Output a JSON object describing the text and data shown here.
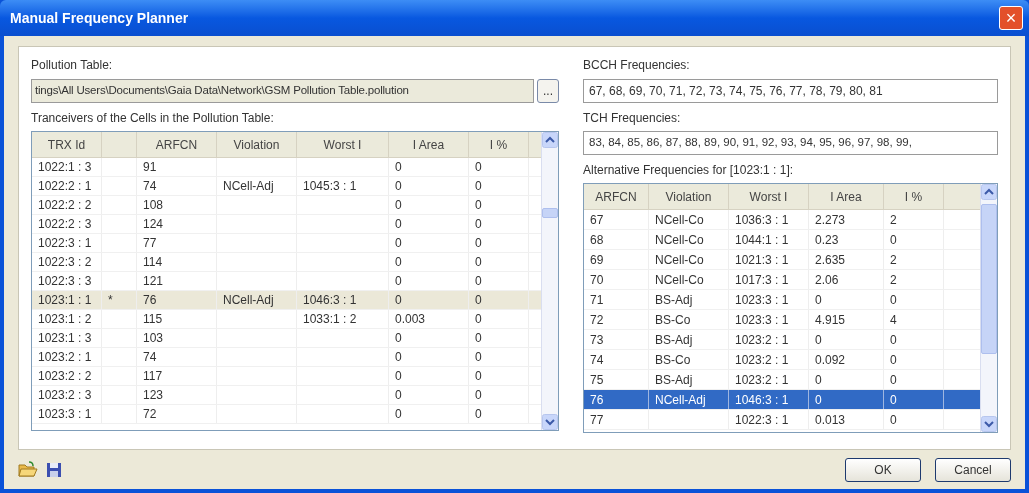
{
  "window": {
    "title": "Manual Frequency Planner",
    "close": "×"
  },
  "pollution_table": {
    "label": "Pollution Table:",
    "value": "tings\\All Users\\Documents\\Gaia Data\\Network\\GSM Pollution Table.pollution",
    "browse_button": "..."
  },
  "transceivers": {
    "label": "Tranceivers of the Cells in the Pollution Table:",
    "columns": [
      "TRX Id",
      "ARFCN",
      "Violation",
      "Worst I",
      "I Area",
      "I %"
    ],
    "rows": [
      {
        "trx_id": "1022:1 : 3",
        "arfcn": "91",
        "i_area": "0",
        "i_pct": "0",
        "selected": false
      },
      {
        "trx_id": "1022:2 : 1",
        "arfcn": "74",
        "violation": "NCell-Adj",
        "worst_i": "1045:3 : 1",
        "i_area": "0",
        "i_pct": "0",
        "selected": false
      },
      {
        "trx_id": "1022:2 : 2",
        "arfcn": "108",
        "i_area": "0",
        "i_pct": "0",
        "selected": false
      },
      {
        "trx_id": "1022:2 : 3",
        "arfcn": "124",
        "i_area": "0",
        "i_pct": "0",
        "selected": false
      },
      {
        "trx_id": "1022:3 : 1",
        "arfcn": "77",
        "i_area": "0",
        "i_pct": "0",
        "selected": false
      },
      {
        "trx_id": "1022:3 : 2",
        "arfcn": "114",
        "i_area": "0",
        "i_pct": "0",
        "selected": false
      },
      {
        "trx_id": "1022:3 : 3",
        "arfcn": "121",
        "i_area": "0",
        "i_pct": "0",
        "selected": false
      },
      {
        "trx_id": "1023:1 : 1",
        "marker": "*",
        "arfcn": "76",
        "violation": "NCell-Adj",
        "worst_i": "1046:3 : 1",
        "i_area": "0",
        "i_pct": "0",
        "selected": true
      },
      {
        "trx_id": "1023:1 : 2",
        "arfcn": "115",
        "worst_i": "1033:1 : 2",
        "i_area": "0.003",
        "i_pct": "0",
        "selected": false
      },
      {
        "trx_id": "1023:1 : 3",
        "arfcn": "103",
        "i_area": "0",
        "i_pct": "0",
        "selected": false
      },
      {
        "trx_id": "1023:2 : 1",
        "arfcn": "74",
        "i_area": "0",
        "i_pct": "0",
        "selected": false
      },
      {
        "trx_id": "1023:2 : 2",
        "arfcn": "117",
        "i_area": "0",
        "i_pct": "0",
        "selected": false
      },
      {
        "trx_id": "1023:2 : 3",
        "arfcn": "123",
        "i_area": "0",
        "i_pct": "0",
        "selected": false
      },
      {
        "trx_id": "1023:3 : 1",
        "arfcn": "72",
        "i_area": "0",
        "i_pct": "0",
        "selected": false
      }
    ]
  },
  "bcch": {
    "label": "BCCH Frequencies:",
    "value": "67, 68, 69, 70, 71, 72, 73, 74, 75, 76, 77, 78, 79, 80, 81"
  },
  "tch": {
    "label": "TCH Frequencies:",
    "value": "83, 84, 85, 86, 87, 88, 89, 90, 91, 92, 93, 94, 95, 96, 97, 98, 99,"
  },
  "alternatives": {
    "label": "Alternative Frequencies for [1023:1 : 1]:",
    "columns": [
      "ARFCN",
      "Violation",
      "Worst I",
      "I Area",
      "I %"
    ],
    "rows": [
      {
        "arfcn": "67",
        "violation": "NCell-Co",
        "worst_i": "1036:3 : 1",
        "i_area": "2.273",
        "i_pct": "2",
        "selected": false
      },
      {
        "arfcn": "68",
        "violation": "NCell-Co",
        "worst_i": "1044:1 : 1",
        "i_area": "0.23",
        "i_pct": "0",
        "selected": false
      },
      {
        "arfcn": "69",
        "violation": "NCell-Co",
        "worst_i": "1021:3 : 1",
        "i_area": "2.635",
        "i_pct": "2",
        "selected": false
      },
      {
        "arfcn": "70",
        "violation": "NCell-Co",
        "worst_i": "1017:3 : 1",
        "i_area": "2.06",
        "i_pct": "2",
        "selected": false
      },
      {
        "arfcn": "71",
        "violation": "BS-Adj",
        "worst_i": "1023:3 : 1",
        "i_area": "0",
        "i_pct": "0",
        "selected": false
      },
      {
        "arfcn": "72",
        "violation": "BS-Co",
        "worst_i": "1023:3 : 1",
        "i_area": "4.915",
        "i_pct": "4",
        "selected": false
      },
      {
        "arfcn": "73",
        "violation": "BS-Adj",
        "worst_i": "1023:2 : 1",
        "i_area": "0",
        "i_pct": "0",
        "selected": false
      },
      {
        "arfcn": "74",
        "violation": "BS-Co",
        "worst_i": "1023:2 : 1",
        "i_area": "0.092",
        "i_pct": "0",
        "selected": false
      },
      {
        "arfcn": "75",
        "violation": "BS-Adj",
        "worst_i": "1023:2 : 1",
        "i_area": "0",
        "i_pct": "0",
        "selected": false
      },
      {
        "arfcn": "76",
        "violation": "NCell-Adj",
        "worst_i": "1046:3 : 1",
        "i_area": "0",
        "i_pct": "0",
        "selected": true
      },
      {
        "arfcn": "77",
        "worst_i": "1022:3 : 1",
        "i_area": "0.013",
        "i_pct": "0",
        "selected": false
      }
    ]
  },
  "buttons": [
    "OK",
    "Cancel"
  ]
}
